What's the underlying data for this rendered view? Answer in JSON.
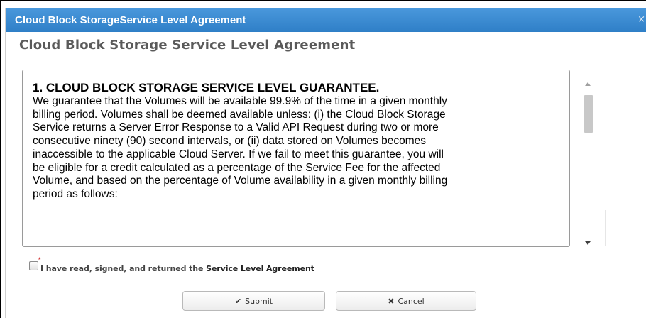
{
  "dialog": {
    "title": "Cloud Block StorageService Level Agreement",
    "close_icon": "×"
  },
  "heading": "Cloud Block Storage Service Level Agreement",
  "content": {
    "heading": "1. CLOUD BLOCK STORAGE SERVICE LEVEL GUARANTEE.",
    "lines": [
      "We guarantee that the Volumes will be available 99.9% of the time in a given monthly",
      "billing period. Volumes shall be deemed available unless: (i) the Cloud Block Storage",
      "Service returns a Server Error Response to a Valid API Request during two or more",
      "consecutive ninety (90) second intervals, or (ii) data stored on Volumes becomes",
      "inaccessible to the applicable Cloud Server. If we fail to meet this guarantee, you will",
      "be eligible for a credit calculated as a percentage of the Service Fee for the affected",
      "Volume, and based on the percentage of Volume availability in a given monthly billing",
      "period as follows:"
    ]
  },
  "agreement": {
    "required_mark": "*",
    "label_prefix": "I have read, signed, and returned the ",
    "label_link": "Service Level Agreement",
    "checked": false
  },
  "buttons": {
    "submit_label": "Submit",
    "submit_icon": "✔",
    "cancel_label": "Cancel",
    "cancel_icon": "✖"
  },
  "colors": {
    "title_bar": "#3d8fd6",
    "required": "#d43b3b"
  },
  "icons": [
    "close-icon",
    "check-icon",
    "x-icon",
    "scroll-up-arrow-icon",
    "scroll-down-arrow-icon"
  ]
}
